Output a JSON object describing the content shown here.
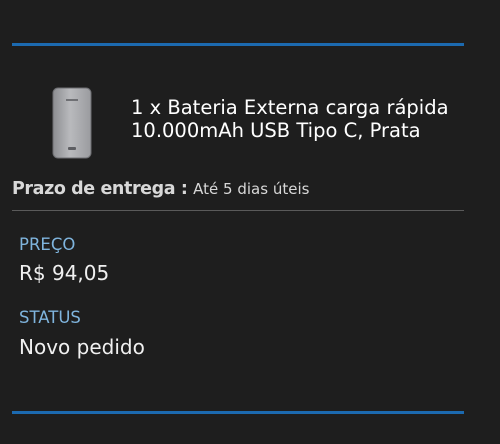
{
  "order_item": {
    "product_name": "1 x Bateria Externa carga rápida 10.000mAh USB Tipo C, Prata",
    "image_icon": "power-bank-image",
    "delivery": {
      "label": "Prazo de entrega : ",
      "value": "Até 5 dias úteis"
    },
    "price": {
      "label": "PREÇO",
      "value": "R$ 94,05"
    },
    "status": {
      "label": "STATUS",
      "value": "Novo pedido"
    }
  },
  "colors": {
    "background": "#1e1e1e",
    "accent_divider": "#1c6ab0",
    "section_label": "#7fb4dd",
    "text": "#ffffff"
  }
}
